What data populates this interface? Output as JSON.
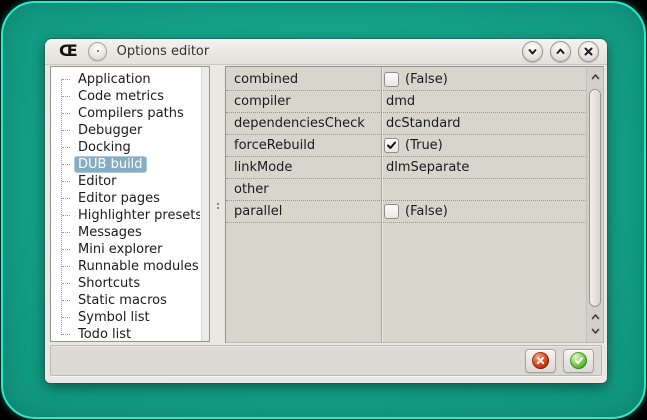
{
  "window": {
    "title": "Options editor",
    "app_icon_glyph": "Œ",
    "controls": [
      {
        "name": "minimize",
        "icon": "chevron-down-icon"
      },
      {
        "name": "maximize",
        "icon": "chevron-up-icon"
      },
      {
        "name": "close",
        "icon": "close-icon"
      }
    ]
  },
  "sidebar": {
    "items": [
      {
        "label": "Application",
        "selected": false
      },
      {
        "label": "Code metrics",
        "selected": false
      },
      {
        "label": "Compilers paths",
        "selected": false
      },
      {
        "label": "Debugger",
        "selected": false
      },
      {
        "label": "Docking",
        "selected": false
      },
      {
        "label": "DUB build",
        "selected": true
      },
      {
        "label": "Editor",
        "selected": false
      },
      {
        "label": "Editor pages",
        "selected": false
      },
      {
        "label": "Highlighter presets",
        "selected": false
      },
      {
        "label": "Messages",
        "selected": false
      },
      {
        "label": "Mini explorer",
        "selected": false
      },
      {
        "label": "Runnable modules",
        "selected": false
      },
      {
        "label": "Shortcuts",
        "selected": false
      },
      {
        "label": "Static macros",
        "selected": false
      },
      {
        "label": "Symbol list",
        "selected": false
      },
      {
        "label": "Todo list",
        "selected": false
      }
    ]
  },
  "property_grid": {
    "rows": [
      {
        "name": "combined",
        "kind": "bool",
        "checked": false,
        "value": "(False)"
      },
      {
        "name": "compiler",
        "kind": "text",
        "value": "dmd"
      },
      {
        "name": "dependenciesCheck",
        "kind": "text",
        "value": "dcStandard"
      },
      {
        "name": "forceRebuild",
        "kind": "bool",
        "checked": true,
        "value": "(True)"
      },
      {
        "name": "linkMode",
        "kind": "text",
        "value": "dlmSeparate"
      },
      {
        "name": "other",
        "kind": "text",
        "value": ""
      },
      {
        "name": "parallel",
        "kind": "bool",
        "checked": false,
        "value": "(False)"
      }
    ]
  },
  "footer": {
    "buttons": [
      {
        "name": "cancel",
        "icon": "cancel-icon",
        "color": "#ad2a10"
      },
      {
        "name": "accept",
        "icon": "accept-icon",
        "color": "#49a426"
      }
    ]
  },
  "colors": {
    "desktop_teal": "#14a188",
    "desktop_edge": "#2de9ca",
    "desktop_outside": "#000000",
    "window_bg": "#eae8e3",
    "panel_white": "#ffffff",
    "grid_bg": "#d7d5cc",
    "selection_bg": "#86aec3",
    "cancel_red": "#ad2a10",
    "accept_green": "#49a426"
  }
}
